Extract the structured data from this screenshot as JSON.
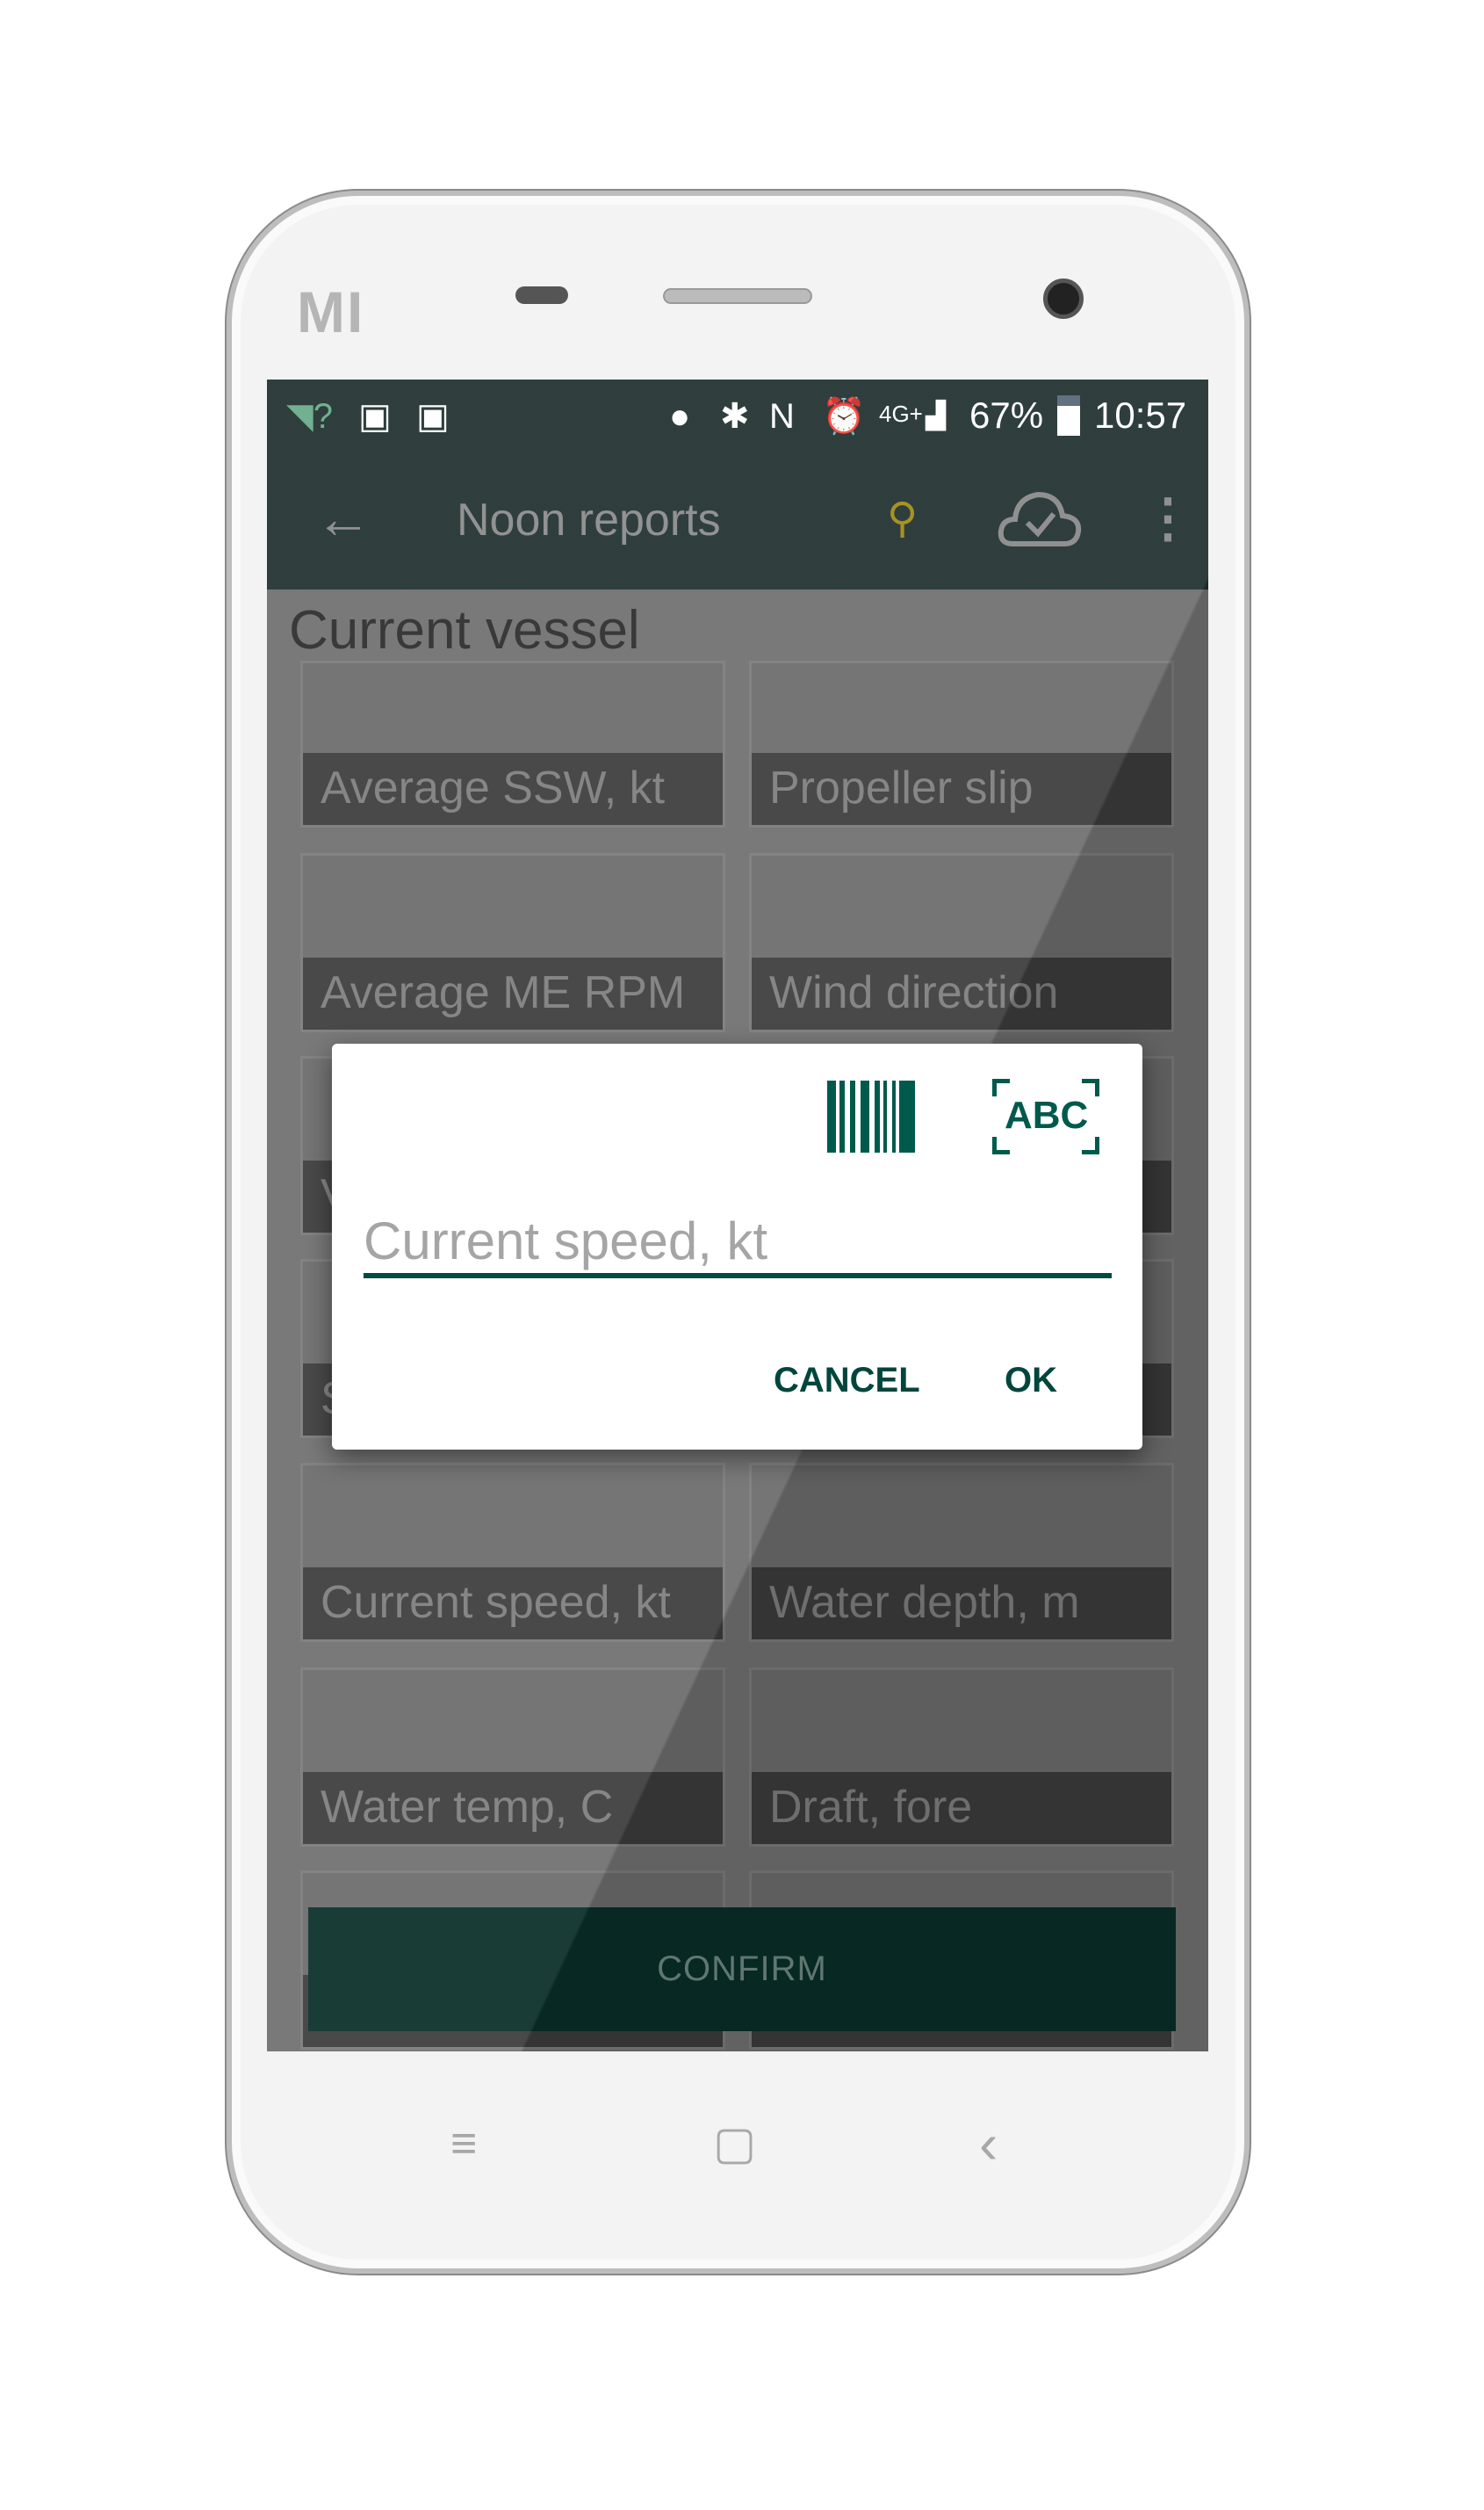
{
  "device": {
    "brand_logo": "MI"
  },
  "status_bar": {
    "battery": "67%",
    "time": "10:57",
    "network": "4G+",
    "icons": [
      "wifi-question-icon",
      "gallery-icon",
      "activity-icon",
      "location-icon",
      "bluetooth-icon",
      "nfc-icon",
      "alarm-icon",
      "signal-icon",
      "battery-icon"
    ]
  },
  "toolbar": {
    "title": "Noon reports",
    "icons": [
      "back-arrow-icon",
      "location-clock-icon",
      "cloud-check-icon",
      "more-vert-icon"
    ],
    "pin_color": "#a08a12"
  },
  "section": {
    "title": "Current vessel"
  },
  "cards": [
    {
      "label": "Average SSW, kt"
    },
    {
      "label": "Propeller slip"
    },
    {
      "label": "Average ME RPM"
    },
    {
      "label": "Wind direction"
    },
    {
      "label": "V"
    },
    {
      "label": ""
    },
    {
      "label": "S"
    },
    {
      "label": ""
    },
    {
      "label": "Current speed, kt"
    },
    {
      "label": "Water depth, m"
    },
    {
      "label": "Water temp, C"
    },
    {
      "label": "Draft, fore"
    },
    {
      "label": ""
    },
    {
      "label": ""
    }
  ],
  "confirm_label": "CONFIRM",
  "dialog": {
    "input_placeholder": "Current speed, kt",
    "ocr_label": "ABC",
    "cancel": "CANCEL",
    "ok": "OK",
    "accent": "#005a4c"
  },
  "nav_bar": {
    "menu": "≡",
    "home": "▢",
    "back": "‹"
  }
}
